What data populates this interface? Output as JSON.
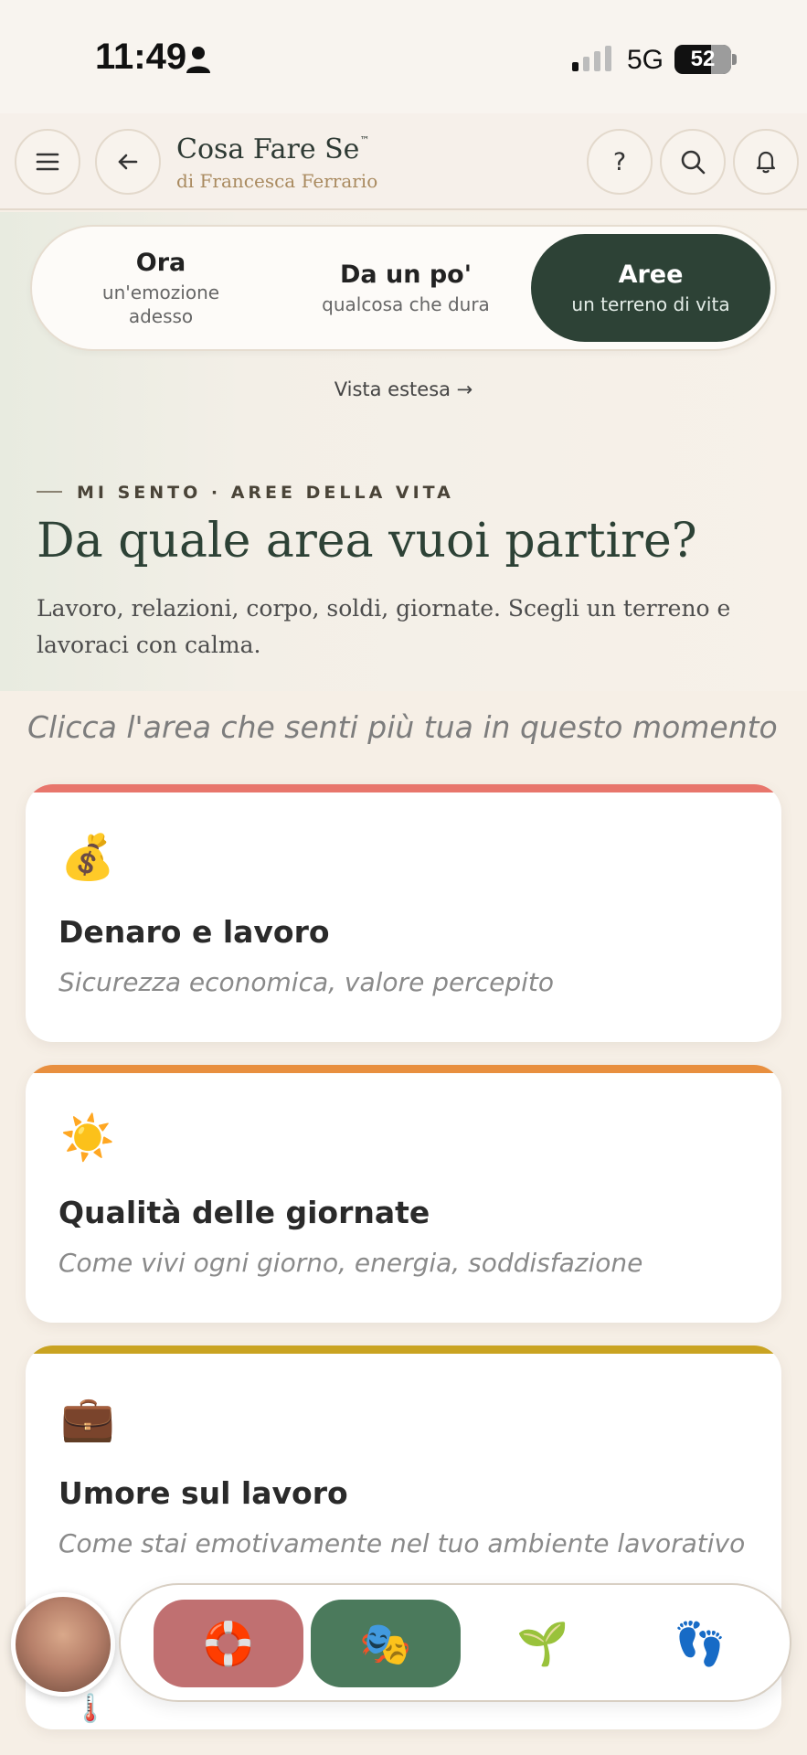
{
  "status": {
    "time": "11:49",
    "network": "5G",
    "battery": "52"
  },
  "header": {
    "title": "Cosa Fare Se",
    "trademark": "™",
    "subtitle": "di Francesca Ferrario",
    "icons": [
      "menu-icon",
      "back-icon",
      "help-icon",
      "search-icon",
      "bell-icon"
    ],
    "help_glyph": "?"
  },
  "tabs": [
    {
      "title": "Ora",
      "subtitle": "un'emozione adesso",
      "active": false
    },
    {
      "title": "Da un po'",
      "subtitle": "qualcosa che dura",
      "active": false
    },
    {
      "title": "Aree",
      "subtitle": "un terreno di vita",
      "active": true
    }
  ],
  "extended_view": "Vista estesa →",
  "hero": {
    "eyebrow": "MI SENTO · AREE DELLA VITA",
    "title": "Da quale area vuoi partire?",
    "description": "Lavoro, relazioni, corpo, soldi, giornate. Scegli un terreno e lavoraci con calma."
  },
  "instruction": "Clicca l'area che senti più tua in questo momento",
  "cards": [
    {
      "emoji": "💰",
      "title": "Denaro e lavoro",
      "subtitle": "Sicurezza economica, valore percepito",
      "color": "#e8766c"
    },
    {
      "emoji": "☀️",
      "title": "Qualità delle giornate",
      "subtitle": "Come vivi ogni giorno, energia, soddisfazione",
      "color": "#e88f3f"
    },
    {
      "emoji": "💼",
      "title": "Umore sul lavoro",
      "subtitle": "Come stai emotivamente nel tuo ambiente lavorativo",
      "color": "#c9a322"
    }
  ],
  "bottom_nav": {
    "items": [
      {
        "icon": "🛟",
        "name": "lifebuoy-icon",
        "bg": "#c07071"
      },
      {
        "icon": "🎭",
        "name": "theater-masks-icon",
        "bg": "#4b7a5c"
      },
      {
        "icon": "🌱",
        "name": "sprout-icon",
        "bg": "transparent"
      },
      {
        "icon": "👣",
        "name": "footprints-icon",
        "bg": "transparent"
      }
    ],
    "thermometer": "🌡️"
  },
  "colors": {
    "accent": "#2d4236",
    "background": "#f6efe6",
    "gold": "#a98a5f"
  }
}
